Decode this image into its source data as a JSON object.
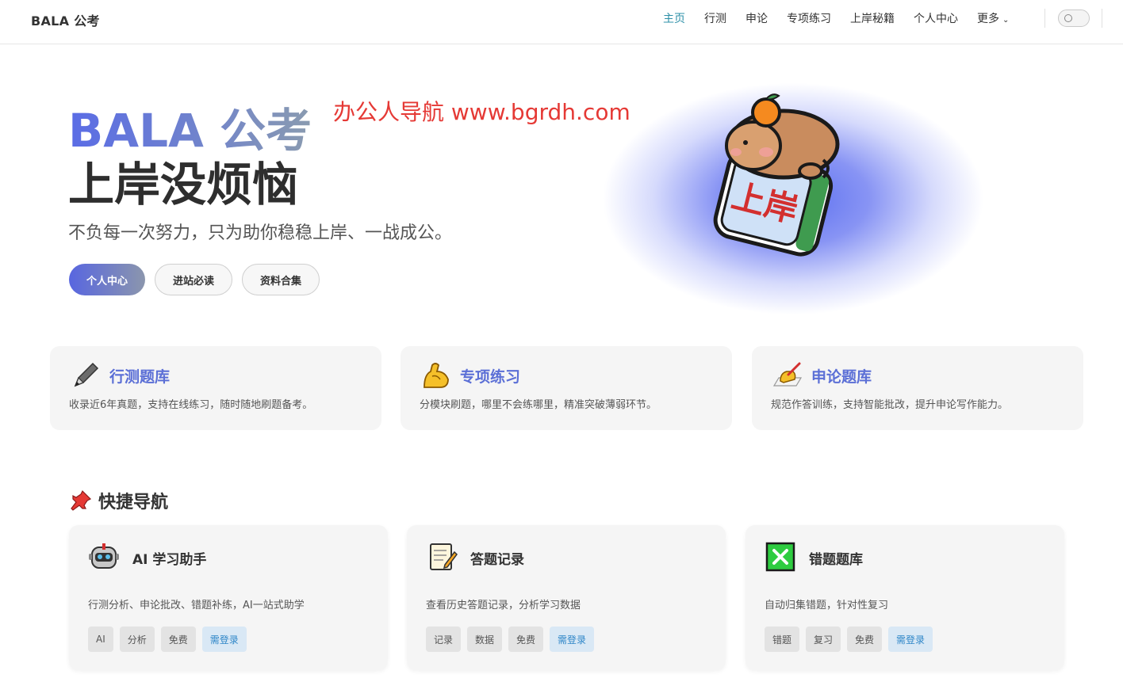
{
  "nav": {
    "brand": "BALA 公考",
    "items": [
      {
        "label": "主页",
        "active": true
      },
      {
        "label": "行测"
      },
      {
        "label": "申论"
      },
      {
        "label": "专项练习"
      },
      {
        "label": "上岸秘籍"
      },
      {
        "label": "个人中心"
      },
      {
        "label": "更多"
      }
    ]
  },
  "hero": {
    "title1": "BALA 公考",
    "title2": "上岸没烦恼",
    "subtitle": "不负每一次努力，只为助你稳稳上岸、一战成公。",
    "watermark": "办公人导航 www.bgrdh.com",
    "mascot_badge": "上岸",
    "buttons": [
      "个人中心",
      "进站必读",
      "资料合集"
    ]
  },
  "features": [
    {
      "title": "行测题库",
      "desc": "收录近6年真题，支持在线练习，随时随地刷题备考。",
      "icon": "pen-icon"
    },
    {
      "title": "专项练习",
      "desc": "分模块刷题，哪里不会练哪里，精准突破薄弱环节。",
      "icon": "flexed-arm-icon"
    },
    {
      "title": "申论题库",
      "desc": "规范作答训练，支持智能批改，提升申论写作能力。",
      "icon": "writing-hand-icon"
    }
  ],
  "quick_nav": {
    "title": "快捷导航",
    "cards": [
      {
        "title": "AI 学习助手",
        "desc": "行测分析、申论批改、错题补练，AI一站式助学",
        "tags": [
          "AI",
          "分析",
          "免费",
          "需登录"
        ],
        "icon": "robot-icon"
      },
      {
        "title": "答题记录",
        "desc": "查看历史答题记录，分析学习数据",
        "tags": [
          "记录",
          "数据",
          "免费",
          "需登录"
        ],
        "icon": "memo-icon"
      },
      {
        "title": "错题题库",
        "desc": "自动归集错题，针对性复习",
        "tags": [
          "错题",
          "复习",
          "免费",
          "需登录"
        ],
        "icon": "cross-mark-icon"
      }
    ]
  },
  "colors": {
    "accent": "#5b6fd6",
    "nav_active": "#2e90a8",
    "login_tag": "#2e86c8",
    "watermark": "#e53935"
  }
}
